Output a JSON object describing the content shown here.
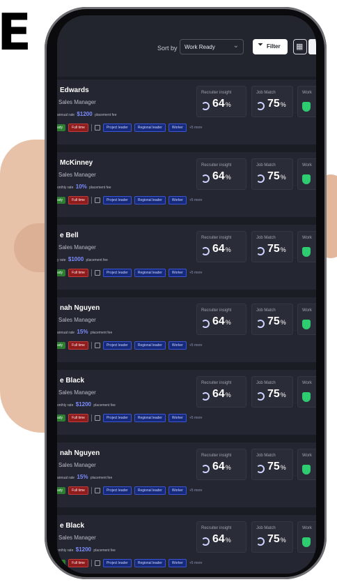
{
  "headline": {
    "letter": "E"
  },
  "toolbar": {
    "sort_label": "Sort by",
    "sort_value": "Work Ready",
    "filter_label": "Filter",
    "view_grid_icon": "grid-icon",
    "view_list_icon": "list-icon"
  },
  "metrics": {
    "recruiter_label": "Recruiter insight",
    "job_match_label": "Job Match",
    "work_label": "Work"
  },
  "candidates": [
    {
      "name": "Edwards",
      "role": "Sales Manager",
      "rate_type": "annual rate",
      "fee_value": "$1200",
      "fee_label": "placement fee",
      "recruiter_insight": "64",
      "job_match": "75"
    },
    {
      "name": "McKinney",
      "role": "Sales Manager",
      "rate_type": "onthly rate",
      "fee_value": "10%",
      "fee_label": "placement fee",
      "recruiter_insight": "64",
      "job_match": "75"
    },
    {
      "name": "e Bell",
      "role": "Sales Manager",
      "rate_type": "y rate",
      "fee_value": "$1000",
      "fee_label": "placement fee",
      "recruiter_insight": "64",
      "job_match": "75"
    },
    {
      "name": "nah Nguyen",
      "role": "Sales Manager",
      "rate_type": "annual rate",
      "fee_value": "15%",
      "fee_label": "placement fee",
      "recruiter_insight": "64",
      "job_match": "75"
    },
    {
      "name": "e Black",
      "role": "Sales Manager",
      "rate_type": "onthly rate",
      "fee_value": "$1200",
      "fee_label": "placement fee",
      "recruiter_insight": "64",
      "job_match": "75"
    },
    {
      "name": "nah Nguyen",
      "role": "Sales Manager",
      "rate_type": "annual rate",
      "fee_value": "15%",
      "fee_label": "placement fee",
      "recruiter_insight": "64",
      "job_match": "75"
    },
    {
      "name": "e Black",
      "role": "Sales Manager",
      "rate_type": "onthly rate",
      "fee_value": "$1200",
      "fee_label": "placement fee",
      "recruiter_insight": "64",
      "job_match": "75"
    }
  ],
  "tags": {
    "ready": "ady",
    "full_time": "Full time",
    "project_leader": "Project leader",
    "regional_leader": "Regional leader",
    "worker": "Worker",
    "more": "+5 more"
  },
  "percent_sign": "%",
  "colors": {
    "accent_blue": "#7b8cff",
    "tag_green": "#2e7d32",
    "tag_red": "#8e1c1c",
    "tag_blue": "#172a7a",
    "shield_green": "#2ecc71"
  }
}
